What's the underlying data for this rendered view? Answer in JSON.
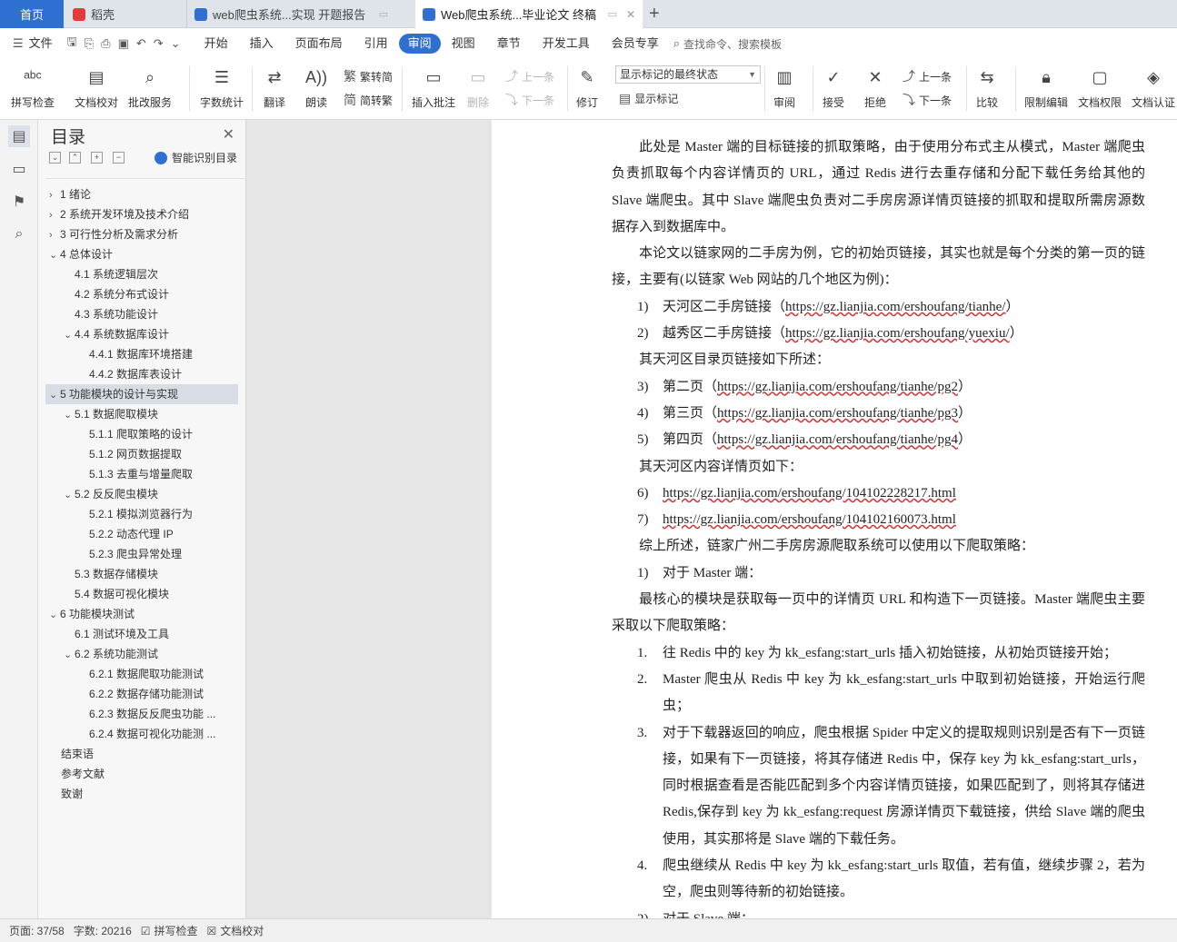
{
  "tabs": {
    "home": "首页",
    "t1": "稻壳",
    "t2": "web爬虫系统...实现 开题报告",
    "t3": "Web爬虫系统...毕业论文 终稿"
  },
  "menu": {
    "file": "文件",
    "items": [
      "开始",
      "插入",
      "页面布局",
      "引用",
      "审阅",
      "视图",
      "章节",
      "开发工具",
      "会员专享"
    ],
    "search": "查找命令、搜索模板"
  },
  "ribbon": {
    "spell": "拼写检查",
    "doccheck": "文档校对",
    "batch": "批改服务",
    "wordcount": "字数统计",
    "translate": "翻译",
    "read": "朗读",
    "t2s": "繁转简",
    "s2t": "简转繁",
    "insertComment": "插入批注",
    "delete": "删除",
    "prev": "上一条",
    "next": "下一条",
    "track": "修订",
    "statusSelect": "显示标记的最终状态",
    "showMarkup": "显示标记",
    "review": "审阅",
    "accept": "接受",
    "reject": "拒绝",
    "prev2": "上一条",
    "next2": "下一条",
    "compare": "比较",
    "restrict": "限制编辑",
    "perm": "文档权限",
    "cert": "文档认证"
  },
  "nav": {
    "title": "目录",
    "smart": "智能识别目录",
    "toc": [
      {
        "label": "1  绪论",
        "level": 1,
        "arrow": "›"
      },
      {
        "label": "2  系统开发环境及技术介绍",
        "level": 1,
        "arrow": "›"
      },
      {
        "label": "3  可行性分析及需求分析",
        "level": 1,
        "arrow": "›"
      },
      {
        "label": "4  总体设计",
        "level": 1,
        "arrow": "⌄"
      },
      {
        "label": "4.1  系统逻辑层次",
        "level": 2,
        "arrow": ""
      },
      {
        "label": "4.2  系统分布式设计",
        "level": 2,
        "arrow": ""
      },
      {
        "label": "4.3  系统功能设计",
        "level": 2,
        "arrow": ""
      },
      {
        "label": "4.4  系统数据库设计",
        "level": 2,
        "arrow": "⌄"
      },
      {
        "label": "4.4.1  数据库环境搭建",
        "level": 3,
        "arrow": ""
      },
      {
        "label": "4.4.2  数据库表设计",
        "level": 3,
        "arrow": ""
      },
      {
        "label": "5  功能模块的设计与实现",
        "level": 1,
        "arrow": "⌄",
        "selected": true
      },
      {
        "label": "5.1  数据爬取模块",
        "level": 2,
        "arrow": "⌄"
      },
      {
        "label": "5.1.1  爬取策略的设计",
        "level": 3,
        "arrow": ""
      },
      {
        "label": "5.1.2  网页数据提取",
        "level": 3,
        "arrow": ""
      },
      {
        "label": "5.1.3  去重与增量爬取",
        "level": 3,
        "arrow": ""
      },
      {
        "label": "5.2  反反爬虫模块",
        "level": 2,
        "arrow": "⌄"
      },
      {
        "label": "5.2.1  模拟浏览器行为",
        "level": 3,
        "arrow": ""
      },
      {
        "label": "5.2.2  动态代理 IP",
        "level": 3,
        "arrow": ""
      },
      {
        "label": "5.2.3  爬虫异常处理",
        "level": 3,
        "arrow": ""
      },
      {
        "label": "5.3  数据存储模块",
        "level": 2,
        "arrow": ""
      },
      {
        "label": "5.4  数据可视化模块",
        "level": 2,
        "arrow": ""
      },
      {
        "label": "6  功能模块测试",
        "level": 1,
        "arrow": "⌄"
      },
      {
        "label": "6.1  测试环境及工具",
        "level": 2,
        "arrow": ""
      },
      {
        "label": "6.2  系统功能测试",
        "level": 2,
        "arrow": "⌄"
      },
      {
        "label": "6.2.1  数据爬取功能测试",
        "level": 3,
        "arrow": ""
      },
      {
        "label": "6.2.2  数据存储功能测试",
        "level": 3,
        "arrow": ""
      },
      {
        "label": "6.2.3  数据反反爬虫功能 ...",
        "level": 3,
        "arrow": ""
      },
      {
        "label": "6.2.4  数据可视化功能测 ...",
        "level": 3,
        "arrow": ""
      },
      {
        "label": "结束语",
        "level": 0,
        "arrow": ""
      },
      {
        "label": "参考文献",
        "level": 0,
        "arrow": ""
      },
      {
        "label": "致谢",
        "level": 0,
        "arrow": ""
      }
    ]
  },
  "doc": {
    "p1": "此处是 Master 端的目标链接的抓取策略，由于使用分布式主从模式，Master 端爬虫负责抓取每个内容详情页的 URL，通过 Redis 进行去重存储和分配下载任务给其他的 Slave 端爬虫。其中 Slave 端爬虫负责对二手房房源详情页链接的抓取和提取所需房源数据存入到数据库中。",
    "p2": "本论文以链家网的二手房为例，它的初始页链接，其实也就是每个分类的第一页的链接，主要有(以链家 Web 网站的几个地区为例)：",
    "l1n": "1)",
    "l1a": "天河区二手房链接（",
    "l1u": "https://gz.lianjia.com/ershoufang/tianhe/",
    "l1b": "）",
    "l2n": "2)",
    "l2a": "越秀区二手房链接（",
    "l2u": "https://gz.lianjia.com/ershoufang/yuexiu/",
    "l2b": "）",
    "p3": "其天河区目录页链接如下所述：",
    "l3n": "3)",
    "l3a": "第二页（",
    "l3u": "https://gz.lianjia.com/ershoufang/tianhe/pg2",
    "l3b": "）",
    "l4n": "4)",
    "l4a": "第三页（",
    "l4u": "https://gz.lianjia.com/ershoufang/tianhe/pg3",
    "l4b": "）",
    "l5n": "5)",
    "l5a": "第四页（",
    "l5u": "https://gz.lianjia.com/ershoufang/tianhe/pg4",
    "l5b": "）",
    "p4": "其天河区内容详情页如下：",
    "l6n": "6)",
    "l6u": "https://gz.lianjia.com/ershoufang/104102228217.html",
    "l7n": "7)",
    "l7u": "https://gz.lianjia.com/ershoufang/104102160073.html",
    "p5": "综上所述，链家广州二手房房源爬取系统可以使用以下爬取策略：",
    "l8n": "1)",
    "l8": "对于 Master 端：",
    "p6": "最核心的模块是获取每一页中的详情页 URL 和构造下一页链接。Master 端爬虫主要采取以下爬取策略：",
    "s1n": "1.",
    "s1": "往 Redis 中的 key 为 kk_esfang:start_urls 插入初始链接，从初始页链接开始；",
    "s2n": "2.",
    "s2": "Master 爬虫从 Redis 中 key 为 kk_esfang:start_urls 中取到初始链接，开始运行爬虫；",
    "s3n": "3.",
    "s3": "对于下载器返回的响应，爬虫根据 Spider 中定义的提取规则识别是否有下一页链接，如果有下一页链接，将其存储进 Redis 中，保存 key 为 kk_esfang:start_urls，同时根据查看是否能匹配到多个内容详情页链接，如果匹配到了，则将其存储进 Redis,保存到 key 为 kk_esfang:request 房源详情页下载链接，供给 Slave 端的爬虫使用，其实那将是 Slave 端的下载任务。",
    "s4n": "4.",
    "s4": "爬虫继续从 Redis 中 key 为 kk_esfang:start_urls 取值，若有值，继续步骤 2，若为空，爬虫则等待新的初始链接。",
    "l9n": "2)",
    "l9": "对于 Slave 端："
  },
  "status": {
    "page": "页面: 37/58",
    "words": "字数: 20216",
    "spell": "拼写检查",
    "proof": "文档校对"
  }
}
